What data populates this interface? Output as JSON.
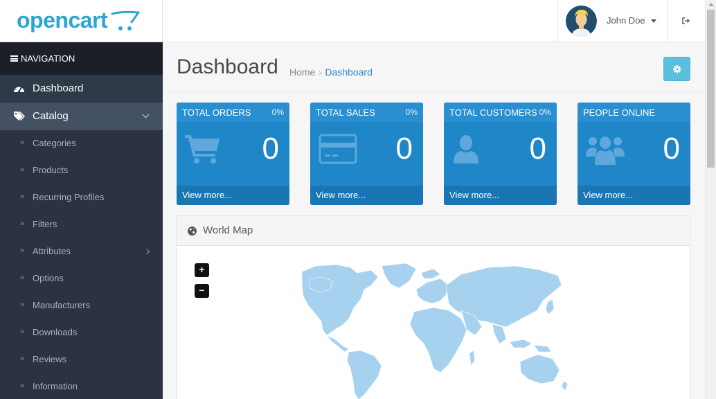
{
  "header": {
    "logo_text": "opencart",
    "user_name": "John Doe"
  },
  "sidebar": {
    "heading": "NAVIGATION",
    "top_items": [
      {
        "label": "Dashboard",
        "icon": "dashboard-gauge-icon"
      },
      {
        "label": "Catalog",
        "icon": "tags-icon"
      }
    ],
    "catalog_items": [
      {
        "label": "Categories"
      },
      {
        "label": "Products"
      },
      {
        "label": "Recurring Profiles"
      },
      {
        "label": "Filters"
      },
      {
        "label": "Attributes"
      },
      {
        "label": "Options"
      },
      {
        "label": "Manufacturers"
      },
      {
        "label": "Downloads"
      },
      {
        "label": "Reviews"
      },
      {
        "label": "Information"
      }
    ]
  },
  "page": {
    "title": "Dashboard",
    "breadcrumb": [
      "Home",
      "Dashboard"
    ]
  },
  "tiles": [
    {
      "title": "TOTAL ORDERS",
      "percent": "0%",
      "value": "0",
      "link": "View more...",
      "icon": "shopping-cart-icon"
    },
    {
      "title": "TOTAL SALES",
      "percent": "0%",
      "value": "0",
      "link": "View more...",
      "icon": "credit-card-icon"
    },
    {
      "title": "TOTAL CUSTOMERS",
      "percent": "0%",
      "value": "0",
      "link": "View more...",
      "icon": "user-icon"
    },
    {
      "title": "PEOPLE ONLINE",
      "value": "0",
      "link": "View more...",
      "icon": "users-group-icon"
    }
  ],
  "map_panel": {
    "title": "World Map",
    "zoom_in": "+",
    "zoom_out": "−"
  },
  "colors": {
    "brand": "#2aa6d4",
    "tile_bg": "#1f86c7",
    "sidebar_bg": "#2b3340",
    "map_land": "#a6d2ef",
    "settings_btn": "#5bc0de"
  }
}
